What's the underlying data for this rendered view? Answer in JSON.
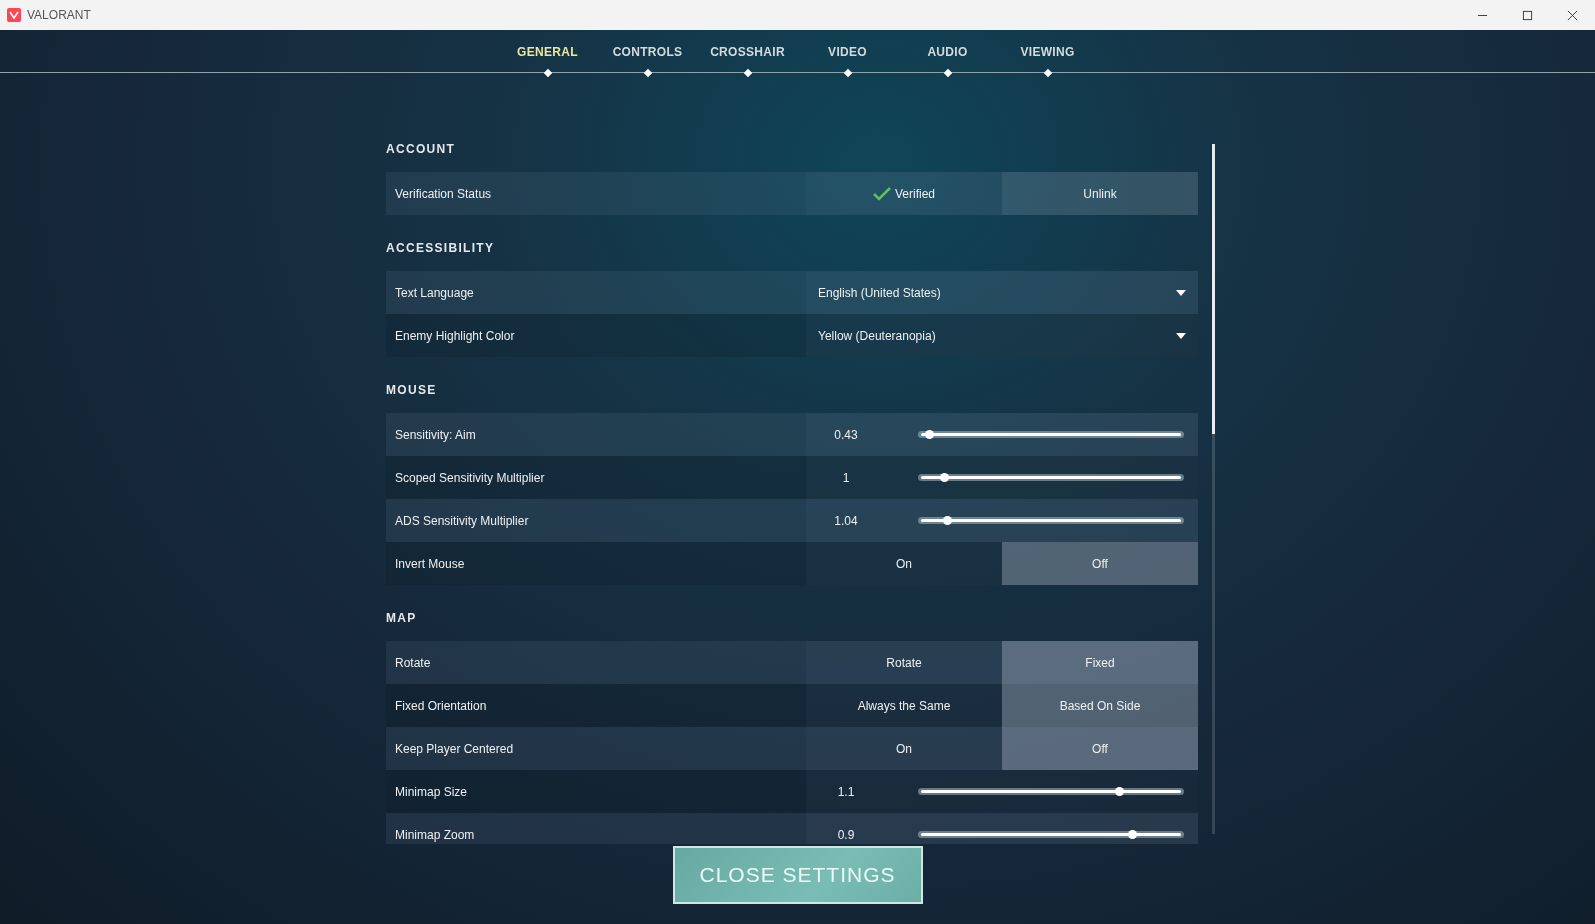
{
  "window": {
    "title": "VALORANT"
  },
  "tabs": [
    {
      "label": "GENERAL",
      "selected": true
    },
    {
      "label": "CONTROLS",
      "selected": false
    },
    {
      "label": "CROSSHAIR",
      "selected": false
    },
    {
      "label": "VIDEO",
      "selected": false
    },
    {
      "label": "AUDIO",
      "selected": false
    },
    {
      "label": "VIEWING",
      "selected": false
    }
  ],
  "sections": [
    {
      "heading": "ACCOUNT",
      "rows": [
        {
          "kind": "verification",
          "label": "Verification Status",
          "status": "Verified",
          "verified": true,
          "button": "Unlink"
        }
      ]
    },
    {
      "heading": "ACCESSIBILITY",
      "rows": [
        {
          "kind": "dropdown",
          "label": "Text Language",
          "value": "English (United States)"
        },
        {
          "kind": "dropdown",
          "label": "Enemy Highlight Color",
          "value": "Yellow (Deuteranopia)"
        }
      ]
    },
    {
      "heading": "MOUSE",
      "rows": [
        {
          "kind": "slider",
          "label": "Sensitivity: Aim",
          "value": "0.43",
          "level": 0.03
        },
        {
          "kind": "slider",
          "label": "Scoped Sensitivity Multiplier",
          "value": "1",
          "level": 0.09
        },
        {
          "kind": "slider",
          "label": "ADS Sensitivity Multiplier",
          "value": "1.04",
          "level": 0.1
        },
        {
          "kind": "toggle",
          "label": "Invert Mouse",
          "options": [
            {
              "label": "On",
              "selected": false
            },
            {
              "label": "Off",
              "selected": true
            }
          ]
        }
      ]
    },
    {
      "heading": "MAP",
      "rows": [
        {
          "kind": "toggle",
          "label": "Rotate",
          "options": [
            {
              "label": "Rotate",
              "selected": false
            },
            {
              "label": "Fixed",
              "selected": true
            }
          ]
        },
        {
          "kind": "toggle",
          "label": "Fixed Orientation",
          "options": [
            {
              "label": "Always the Same",
              "selected": false
            },
            {
              "label": "Based On Side",
              "selected": true
            }
          ]
        },
        {
          "kind": "toggle",
          "label": "Keep Player Centered",
          "options": [
            {
              "label": "On",
              "selected": false
            },
            {
              "label": "Off",
              "selected": true
            }
          ]
        },
        {
          "kind": "slider",
          "label": "Minimap Size",
          "value": "1.1",
          "level": 0.76
        },
        {
          "kind": "slider",
          "label": "Minimap Zoom",
          "value": "0.9",
          "level": 0.81
        }
      ]
    }
  ],
  "close_button": "CLOSE SETTINGS"
}
